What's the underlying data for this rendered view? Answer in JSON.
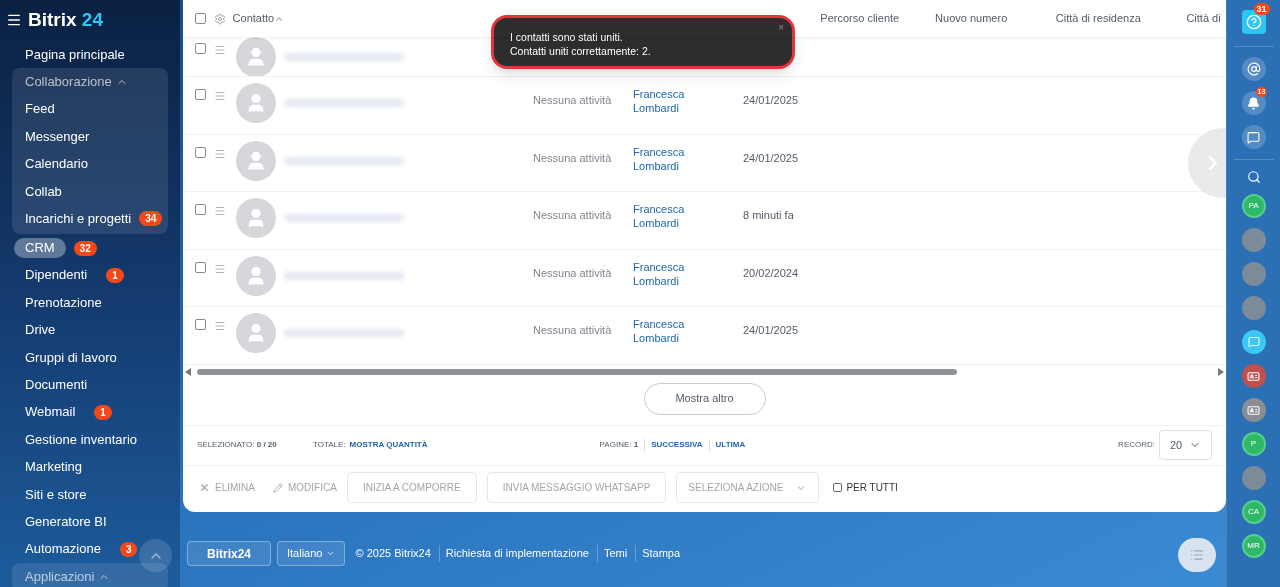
{
  "sidebar": {
    "logo": "Bitrix",
    "logo_accent": "24",
    "items": [
      {
        "kind": "link",
        "label": "Pagina principale",
        "selected": false
      },
      {
        "kind": "group",
        "label": "Collaborazione",
        "expanded": true,
        "children": [
          {
            "label": "Feed"
          },
          {
            "label": "Messenger"
          },
          {
            "label": "Calendario"
          },
          {
            "label": "Collab"
          },
          {
            "label": "Incarichi e progetti",
            "badge": "34"
          }
        ]
      },
      {
        "kind": "link",
        "label": "CRM",
        "badge": "32",
        "selected": true
      },
      {
        "kind": "link",
        "label": "Dipendenti",
        "badge": "1",
        "selected": false
      },
      {
        "kind": "link",
        "label": "Prenotazione",
        "selected": false
      },
      {
        "kind": "link",
        "label": "Drive",
        "selected": false
      },
      {
        "kind": "link",
        "label": "Gruppi di lavoro",
        "selected": false
      },
      {
        "kind": "link",
        "label": "Documenti",
        "selected": false
      },
      {
        "kind": "link",
        "label": "Webmail",
        "badge": "1",
        "selected": false
      },
      {
        "kind": "link",
        "label": "Gestione inventario",
        "selected": false
      },
      {
        "kind": "link",
        "label": "Marketing",
        "selected": false
      },
      {
        "kind": "link",
        "label": "Siti e store",
        "selected": false
      },
      {
        "kind": "link",
        "label": "Generatore BI",
        "selected": false
      },
      {
        "kind": "link",
        "label": "Automazione",
        "badge": "3",
        "selected": false
      },
      {
        "kind": "group",
        "label": "Applicazioni",
        "expanded": true
      }
    ]
  },
  "table": {
    "header_checked": false,
    "columns": [
      {
        "label": "Contatto",
        "sorted": true
      },
      {
        "label": "Percorso cliente"
      },
      {
        "label": "Nuovo numero"
      },
      {
        "label": "Città di residenza"
      },
      {
        "label": "Città di"
      }
    ],
    "rows": [
      {
        "kind": "partial",
        "checked": false
      },
      {
        "kind": "full",
        "checked": false,
        "activity": "Nessuna attività",
        "responsible": "Francesca Lombardi",
        "created": "24/01/2025"
      },
      {
        "kind": "full",
        "checked": false,
        "activity": "Nessuna attività",
        "responsible": "Francesca Lombardi",
        "created": "24/01/2025"
      },
      {
        "kind": "full",
        "checked": false,
        "activity": "Nessuna attività",
        "responsible": "Francesca Lombardi",
        "created": "8 minuti fa"
      },
      {
        "kind": "full",
        "checked": false,
        "activity": "Nessuna attività",
        "responsible": "Francesca Lombardi",
        "created": "20/02/2024"
      },
      {
        "kind": "full",
        "checked": false,
        "activity": "Nessuna attività",
        "responsible": "Francesca Lombardi",
        "created": "24/01/2025"
      }
    ],
    "show_more": "Mostra altro",
    "summary": {
      "selected_label": "SELEZIONATO:",
      "selected_value": "0 / 20",
      "total_label": "TOTALE:",
      "total_link": "MOSTRA QUANTITÀ",
      "pages_label": "PAGINE:",
      "page": "1",
      "next": "SUCCESSIVA",
      "last": "ULTIMA",
      "record_label": "RECORD:",
      "record_value": "20"
    },
    "actions": {
      "delete": "ELIMINA",
      "edit": "MODIFICA",
      "buttons": [
        "INIZIA A COMPORRE",
        "INVIA MESSAGGIO WHATSAPP"
      ],
      "select_action": "SELEZIONA AZIONE",
      "for_all": "PER TUTTI",
      "for_all_checked": false
    }
  },
  "toast": {
    "lines": [
      "I contatti sono stati uniti.",
      "Contatti uniti correttamente: 2."
    ],
    "close": "×"
  },
  "footer": {
    "logo": "Bitrix24",
    "language": "Italiano",
    "copyright": "© 2025 Bitrix24",
    "links": [
      "Richiesta di implementazione",
      "Temi",
      "Stampa"
    ]
  },
  "right_bar": {
    "help_badge": "31",
    "notifications_badge": "13",
    "avatars": [
      {
        "kind": "initials",
        "text": "PA"
      },
      {
        "kind": "photo"
      },
      {
        "kind": "photo"
      },
      {
        "kind": "photo"
      },
      {
        "kind": "chat",
        "color": "#3bc8f5"
      },
      {
        "kind": "card",
        "color": "#c0504d"
      },
      {
        "kind": "card",
        "color": "#8a8d93"
      },
      {
        "kind": "initials",
        "text": "P"
      },
      {
        "kind": "photo"
      },
      {
        "kind": "initials",
        "text": "CA"
      },
      {
        "kind": "initials",
        "text": "MR"
      }
    ]
  }
}
